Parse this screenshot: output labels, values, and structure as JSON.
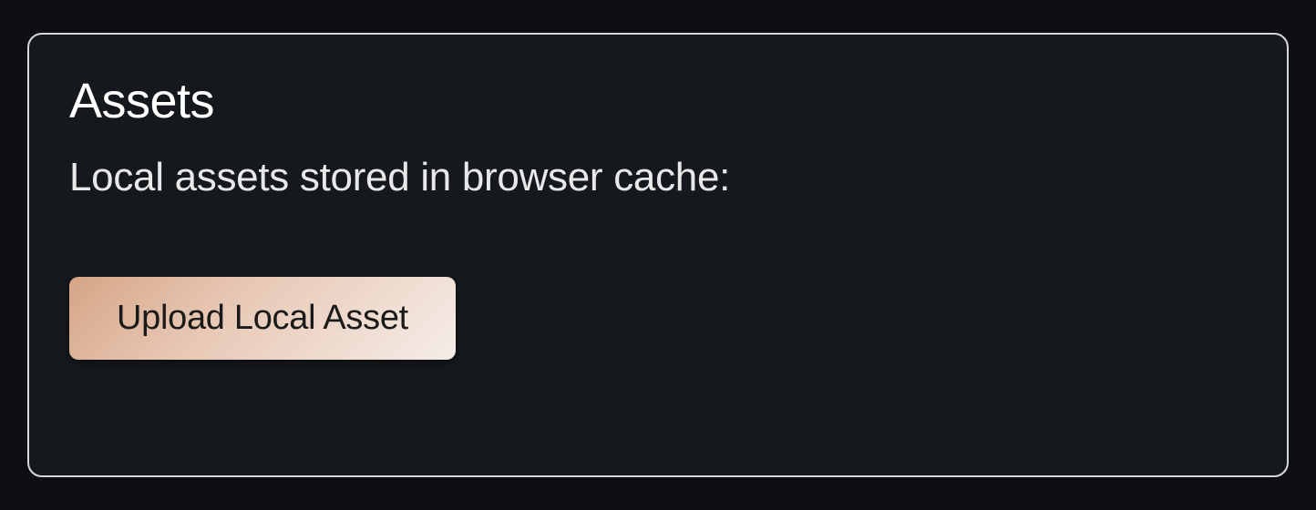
{
  "card": {
    "title": "Assets",
    "description": "Local assets stored in browser cache:",
    "upload_button_label": "Upload Local Asset"
  }
}
